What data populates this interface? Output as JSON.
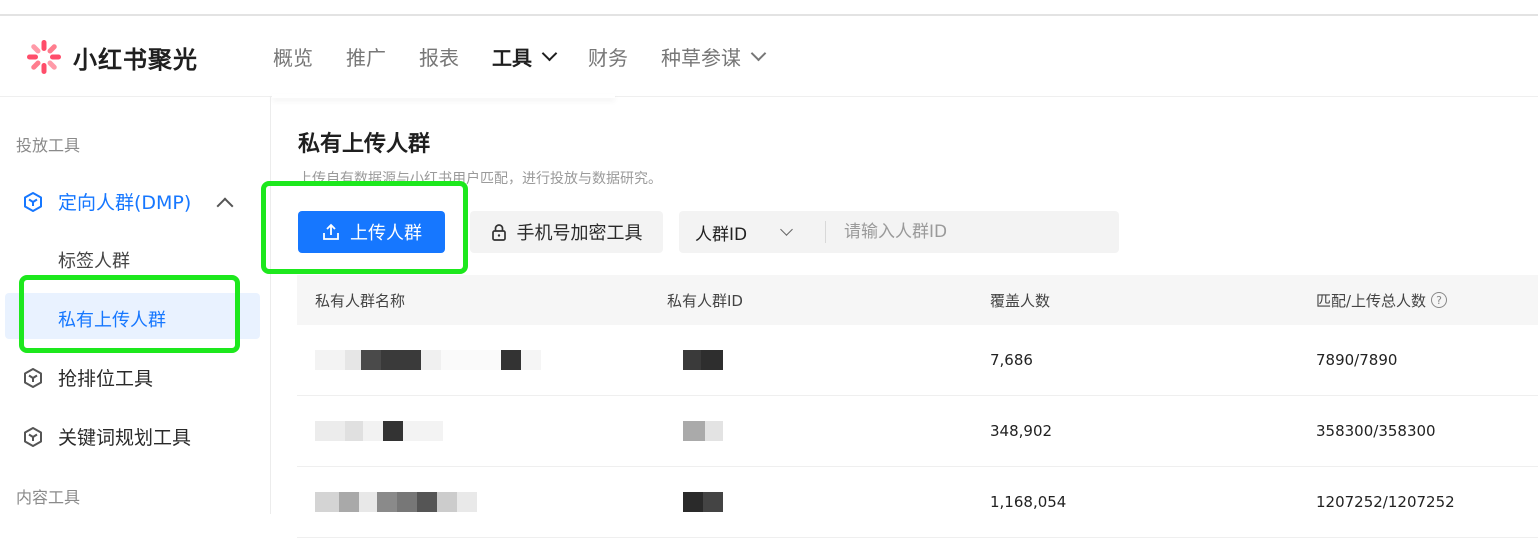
{
  "app": {
    "name": "小红书聚光",
    "accent": "#1677ff",
    "highlight": "#1de81d"
  },
  "nav": {
    "items": [
      {
        "label": "概览",
        "active": false,
        "dropdown": false
      },
      {
        "label": "推广",
        "active": false,
        "dropdown": false
      },
      {
        "label": "报表",
        "active": false,
        "dropdown": false
      },
      {
        "label": "工具",
        "active": true,
        "dropdown": true
      },
      {
        "label": "财务",
        "active": false,
        "dropdown": false
      },
      {
        "label": "种草参谋",
        "active": false,
        "dropdown": true
      }
    ]
  },
  "sidebar": {
    "group1": "投放工具",
    "item_dmp": "定向人群(DMP)",
    "sub_tag": "标签人群",
    "sub_private": "私有上传人群",
    "item_rank": "抢排位工具",
    "item_keyword": "关键词规划工具",
    "group2": "内容工具"
  },
  "main": {
    "title": "私有上传人群",
    "subtitle": "上传自有数据源与小红书用户匹配，进行投放与数据研究。",
    "upload_button": "上传人群",
    "encrypt_button": "手机号加密工具",
    "search_select": "人群ID",
    "search_placeholder": "请输入人群ID"
  },
  "table": {
    "headers": [
      "私有人群名称",
      "私有人群ID",
      "覆盖人数",
      "匹配/上传总人数"
    ],
    "help_glyph": "?",
    "rows": [
      {
        "coverage": "7,686",
        "match": "7890/7890"
      },
      {
        "coverage": "348,902",
        "match": "358300/358300"
      },
      {
        "coverage": "1,168,054",
        "match": "1207252/1207252"
      }
    ]
  }
}
